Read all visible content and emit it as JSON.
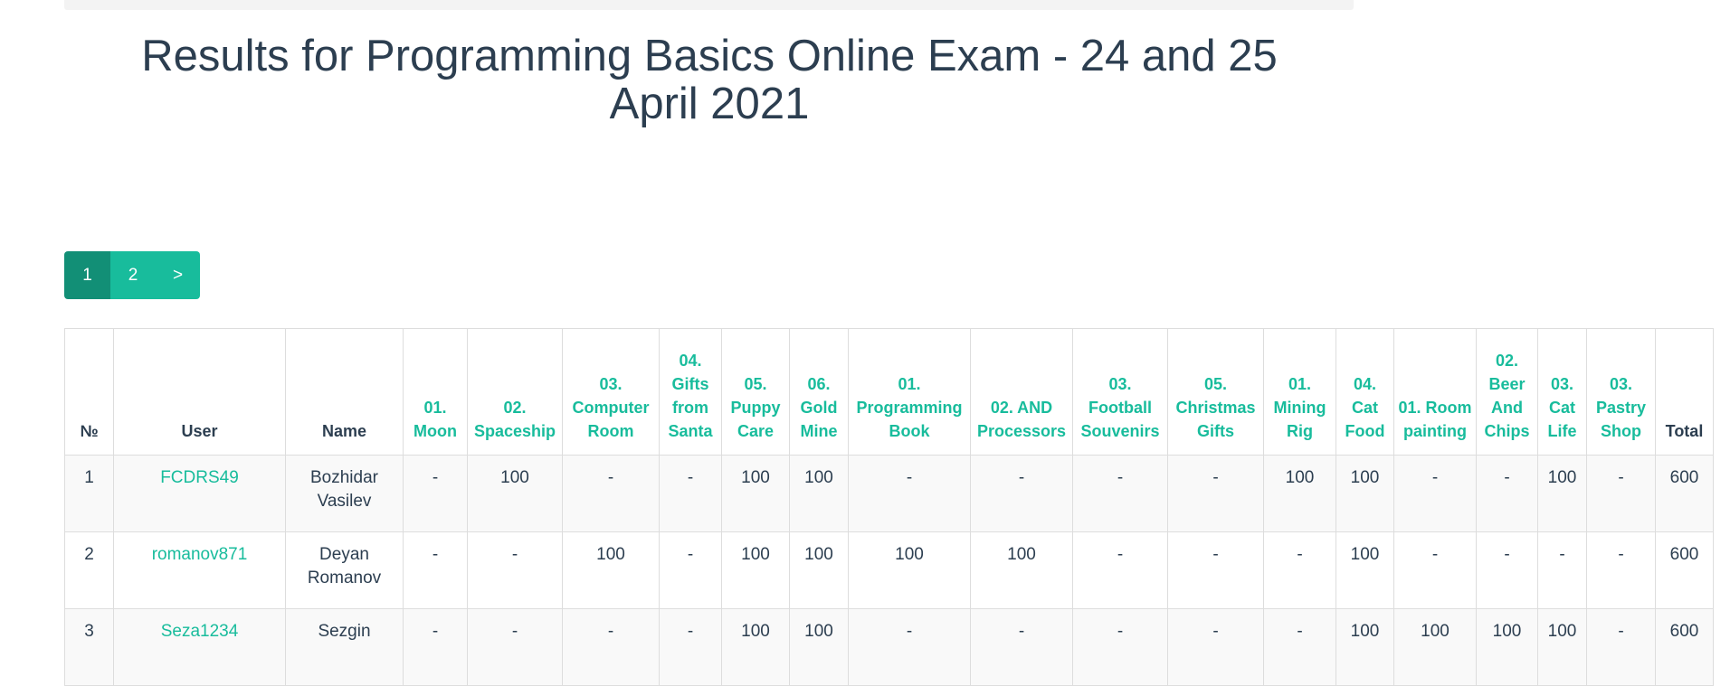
{
  "page": {
    "title": "Results for Programming Basics Online Exam - 24 and 25 April 2021"
  },
  "pagination": {
    "pages": [
      "1",
      "2"
    ],
    "next_label": ">",
    "active": "1"
  },
  "table": {
    "columns": [
      "№",
      "User",
      "Name",
      "01. Moon",
      "02. Spaceship",
      "03. Computer Room",
      "04. Gifts from Santa",
      "05. Puppy Care",
      "06. Gold Mine",
      "01. Programming Book",
      "02. AND Processors",
      "03. Football Souvenirs",
      "05. Christmas Gifts",
      "01. Mining Rig",
      "04. Cat Food",
      "01. Room painting",
      "02. Beer And Chips",
      "03. Cat Life",
      "03. Pastry Shop",
      "Total"
    ],
    "rows": [
      [
        "1",
        "FCDRS49",
        "Bozhidar Vasilev",
        "-",
        "100",
        "-",
        "-",
        "100",
        "100",
        "-",
        "-",
        "-",
        "-",
        "100",
        "100",
        "-",
        "-",
        "100",
        "-",
        "600"
      ],
      [
        "2",
        "romanov871",
        "Deyan Romanov",
        "-",
        "-",
        "100",
        "-",
        "100",
        "100",
        "100",
        "100",
        "-",
        "-",
        "-",
        "100",
        "-",
        "-",
        "-",
        "-",
        "600"
      ],
      [
        "3",
        "Seza1234",
        "Sezgin",
        "-",
        "-",
        "-",
        "-",
        "100",
        "100",
        "-",
        "-",
        "-",
        "-",
        "-",
        "100",
        "100",
        "100",
        "100",
        "-",
        "600"
      ]
    ]
  }
}
